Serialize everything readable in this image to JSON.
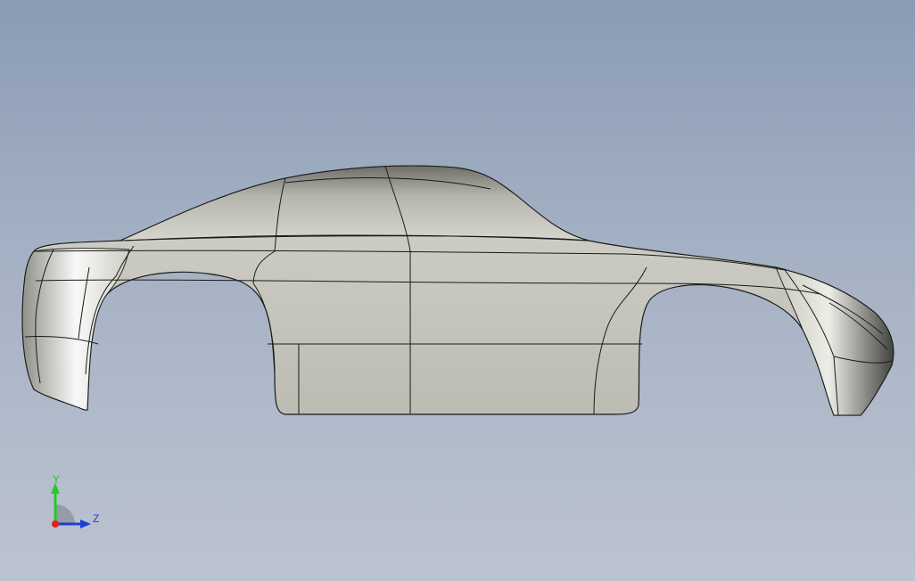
{
  "viewport": {
    "background_top": "#8a9bb4",
    "background_bottom": "#bcc3d0"
  },
  "model": {
    "name": "car-body-side-view",
    "surface_color": "#c8c8bf",
    "edge_color": "#1a1a1a"
  },
  "triad": {
    "y_label": "Y",
    "z_label": "Z",
    "y_color": "#22cc22",
    "z_color": "#1a3fd6",
    "origin_color": "#e02020"
  }
}
